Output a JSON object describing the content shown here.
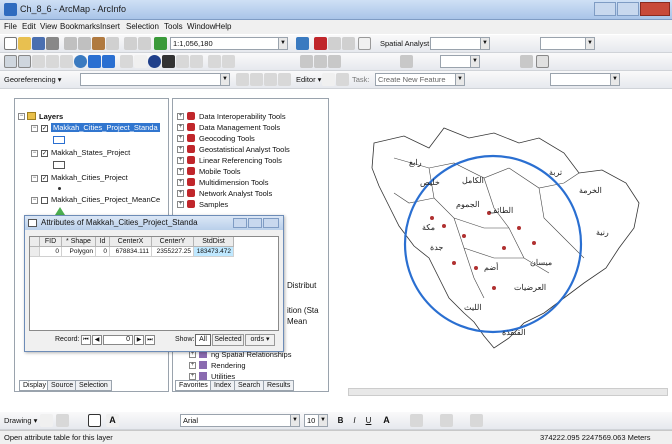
{
  "window": {
    "title": "Ch_8_6 - ArcMap - ArcInfo"
  },
  "menu": [
    "File",
    "Edit",
    "View",
    "Bookmarks",
    "Insert",
    "Selection",
    "Tools",
    "Window",
    "Help"
  ],
  "toolbar1": {
    "scale": "1:1,056,180",
    "spatial_analyst": "Spatial Analyst ▾"
  },
  "toolbar3": {
    "georeferencing": "Georeferencing ▾",
    "editor": "Editor ▾",
    "create": "Create New Feature"
  },
  "toc": {
    "root": "Layers",
    "items": [
      {
        "label": "Makkah_Cities_Project_Standa",
        "selected": true
      },
      {
        "label": "Makkah_States_Project",
        "selected": false
      },
      {
        "label": "Makkah_Cities_Project",
        "selected": false
      },
      {
        "label": "Makkah_Cities_Project_MeanCe",
        "selected": false
      }
    ],
    "tabs": [
      "Display",
      "Source",
      "Selection"
    ]
  },
  "toolbox": {
    "items": [
      "Data Interoperability Tools",
      "Data Management Tools",
      "Geocoding Tools",
      "Geostatistical Analyst Tools",
      "Linear Referencing Tools",
      "Mobile Tools",
      "Multidimension Tools",
      "Network Analyst Tools",
      "Samples"
    ],
    "partial": [
      "Distribut",
      "ition (Sta",
      "Mean"
    ],
    "bottom": [
      "ng Spatial Relationships",
      "Rendering",
      "Utilities"
    ],
    "tabs": [
      "Favorites",
      "Index",
      "Search",
      "Results"
    ]
  },
  "attr": {
    "title": "Attributes of Makkah_Cities_Project_Standa",
    "columns": [
      "FID",
      "* Shape",
      "Id",
      "CenterX",
      "CenterY",
      "StdDist"
    ],
    "row": [
      "0",
      "Polygon",
      "0",
      "678834.111",
      "2355227.25",
      "183473.472"
    ],
    "record_label": "Record:",
    "record_value": "0",
    "show_label": "Show:",
    "show_all": "All",
    "show_selected": "Selected",
    "options": "ords ▾"
  },
  "drawing": {
    "label": "Drawing ▾",
    "font": "Arial",
    "size": "10"
  },
  "status": {
    "left": "Open attribute table for this layer",
    "coords": "374222.095  2247569.063 Meters"
  },
  "map": {
    "labels": [
      "مكة",
      "الطائف",
      "جدة",
      "الليث",
      "القنفذة",
      "رابغ",
      "خليص",
      "الخرمة",
      "تربة",
      "رنية",
      "الكامل",
      "الجموم",
      "ميسان",
      "العرضيات",
      "أضم"
    ],
    "circle_color": "#2a6fd1"
  }
}
